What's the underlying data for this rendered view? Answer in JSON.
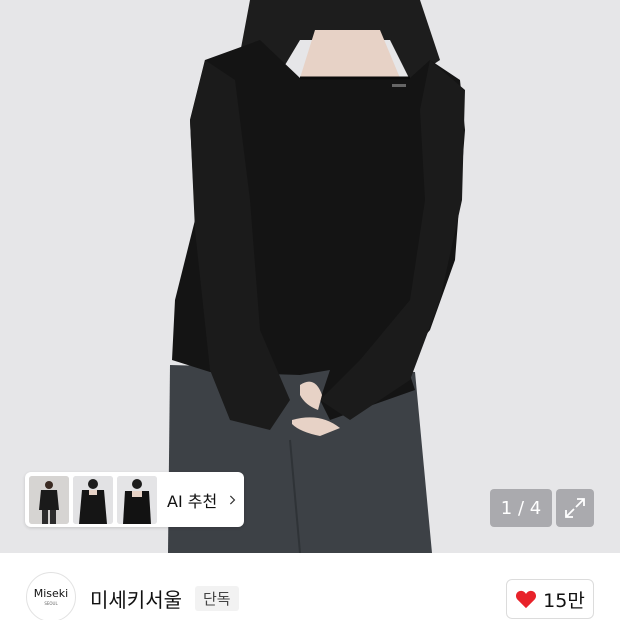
{
  "gallery": {
    "counter": "1 / 4",
    "ai_recommend": {
      "label": "AI 추천"
    }
  },
  "brand": {
    "logo_text": "Miseki",
    "logo_sub": "SEOUL",
    "name": "미세키서울",
    "badge": "단독"
  },
  "like": {
    "count": "15만",
    "icon": "heart-icon",
    "color": "#e8222a"
  }
}
